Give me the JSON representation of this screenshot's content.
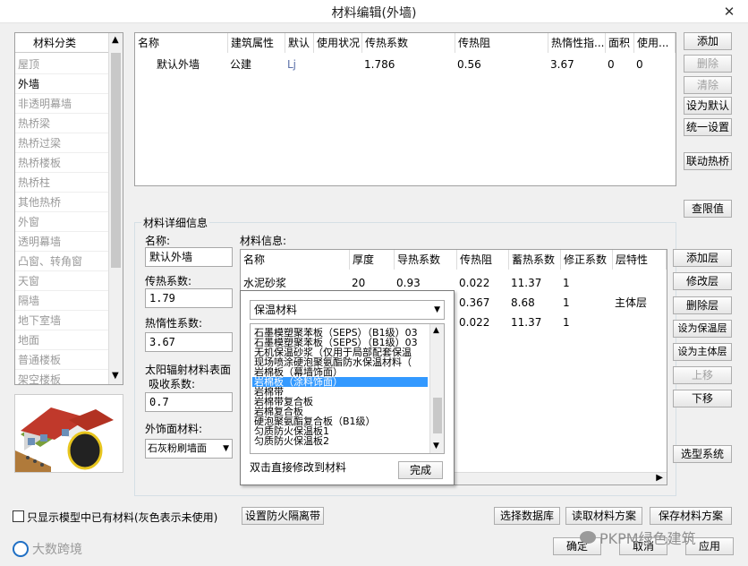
{
  "window": {
    "title": "材料编辑(外墙)",
    "close_glyph": "✕"
  },
  "categories": {
    "header": "材料分类",
    "items": [
      "屋顶",
      "外墙",
      "非透明幕墙",
      "热桥梁",
      "热桥过梁",
      "热桥楼板",
      "热桥柱",
      "其他热桥",
      "外窗",
      "透明幕墙",
      "凸窗、转角窗",
      "天窗",
      "隔墙",
      "地下室墙",
      "地面",
      "普通楼板",
      "架空楼板"
    ],
    "active_index": 1
  },
  "materials_table": {
    "columns": [
      "名称",
      "建筑属性",
      "默认",
      "使用状况",
      "传热系数",
      "传热阻",
      "热惰性指...",
      "面积",
      "使用..."
    ],
    "rows": [
      {
        "name": "默认外墙",
        "attr": "公建",
        "default_icon": "paperclip-icon",
        "status": "",
        "k": "1.786",
        "r": "0.56",
        "d": "3.67",
        "area": "0",
        "use": "0"
      }
    ]
  },
  "right_buttons": {
    "add": "添加",
    "delete": "删除",
    "clear": "清除",
    "set_default": "设为默认",
    "unify": "统一设置",
    "link_bridge": "联动热桥",
    "query_limit": "查限值"
  },
  "detail": {
    "group_title": "材料详细信息",
    "name_label": "名称:",
    "name_value": "默认外墙",
    "k_label": "传热系数:",
    "k_value": "1.79",
    "d_label": "热惰性系数:",
    "d_value": "3.67",
    "solar_label_1": "太阳辐射材料表面",
    "solar_label_2": "吸收系数:",
    "solar_value": "0.7",
    "finish_label": "外饰面材料:",
    "finish_value": "石灰粉刷墙面"
  },
  "layers": {
    "title": "材料信息:",
    "columns": [
      "名称",
      "厚度",
      "导热系数",
      "传热阻",
      "蓄热系数",
      "修正系数",
      "层特性"
    ],
    "rows": [
      {
        "name": "水泥砂浆",
        "thickness": "20",
        "lambda": "0.93",
        "r": "0.022",
        "s": "11.37",
        "a": "1",
        "prop": ""
      },
      {
        "name": "",
        "thickness": "",
        "lambda": "",
        "r": "0.367",
        "s": "8.68",
        "a": "1",
        "prop": "主体层"
      },
      {
        "name": "",
        "thickness": "",
        "lambda": "",
        "r": "0.022",
        "s": "11.37",
        "a": "1",
        "prop": ""
      }
    ]
  },
  "layer_buttons": {
    "add": "添加层",
    "modify": "修改层",
    "delete": "删除层",
    "set_insulation": "设为保温层",
    "set_main": "设为主体层",
    "move_up": "上移",
    "move_down": "下移",
    "select_system": "选型系统"
  },
  "popup": {
    "dropdown_value": "保温材料",
    "options": [
      "石墨模塑聚苯板（SEPS）（B1级）03",
      "石墨模塑聚苯板（SEPS）（B1级）03",
      "无机保温砂浆（仅用于局部配套保温",
      "现场喷涂硬泡聚氨酯防水保温材料（",
      "岩棉板（幕墙饰面）",
      "岩棉板（涂料饰面）",
      "岩棉带",
      "岩棉带复合板",
      "岩棉复合板",
      "硬泡聚氨酯复合板（B1级）",
      "匀质防火保温板1",
      "匀质防火保温板2"
    ],
    "selected_index": 5,
    "hint": "双击直接修改到材料",
    "done": "完成"
  },
  "footer": {
    "checkbox_label": "只显示模型中已有材料(灰色表示未使用)",
    "fire_belt": "设置防火隔离带",
    "select_db": "选择数据库",
    "read_scheme": "读取材料方案",
    "save_scheme": "保存材料方案",
    "ok": "确定",
    "cancel": "取消",
    "apply": "应用"
  },
  "watermarks": {
    "left": "大数跨境",
    "right": "PKPM绿色建筑"
  }
}
